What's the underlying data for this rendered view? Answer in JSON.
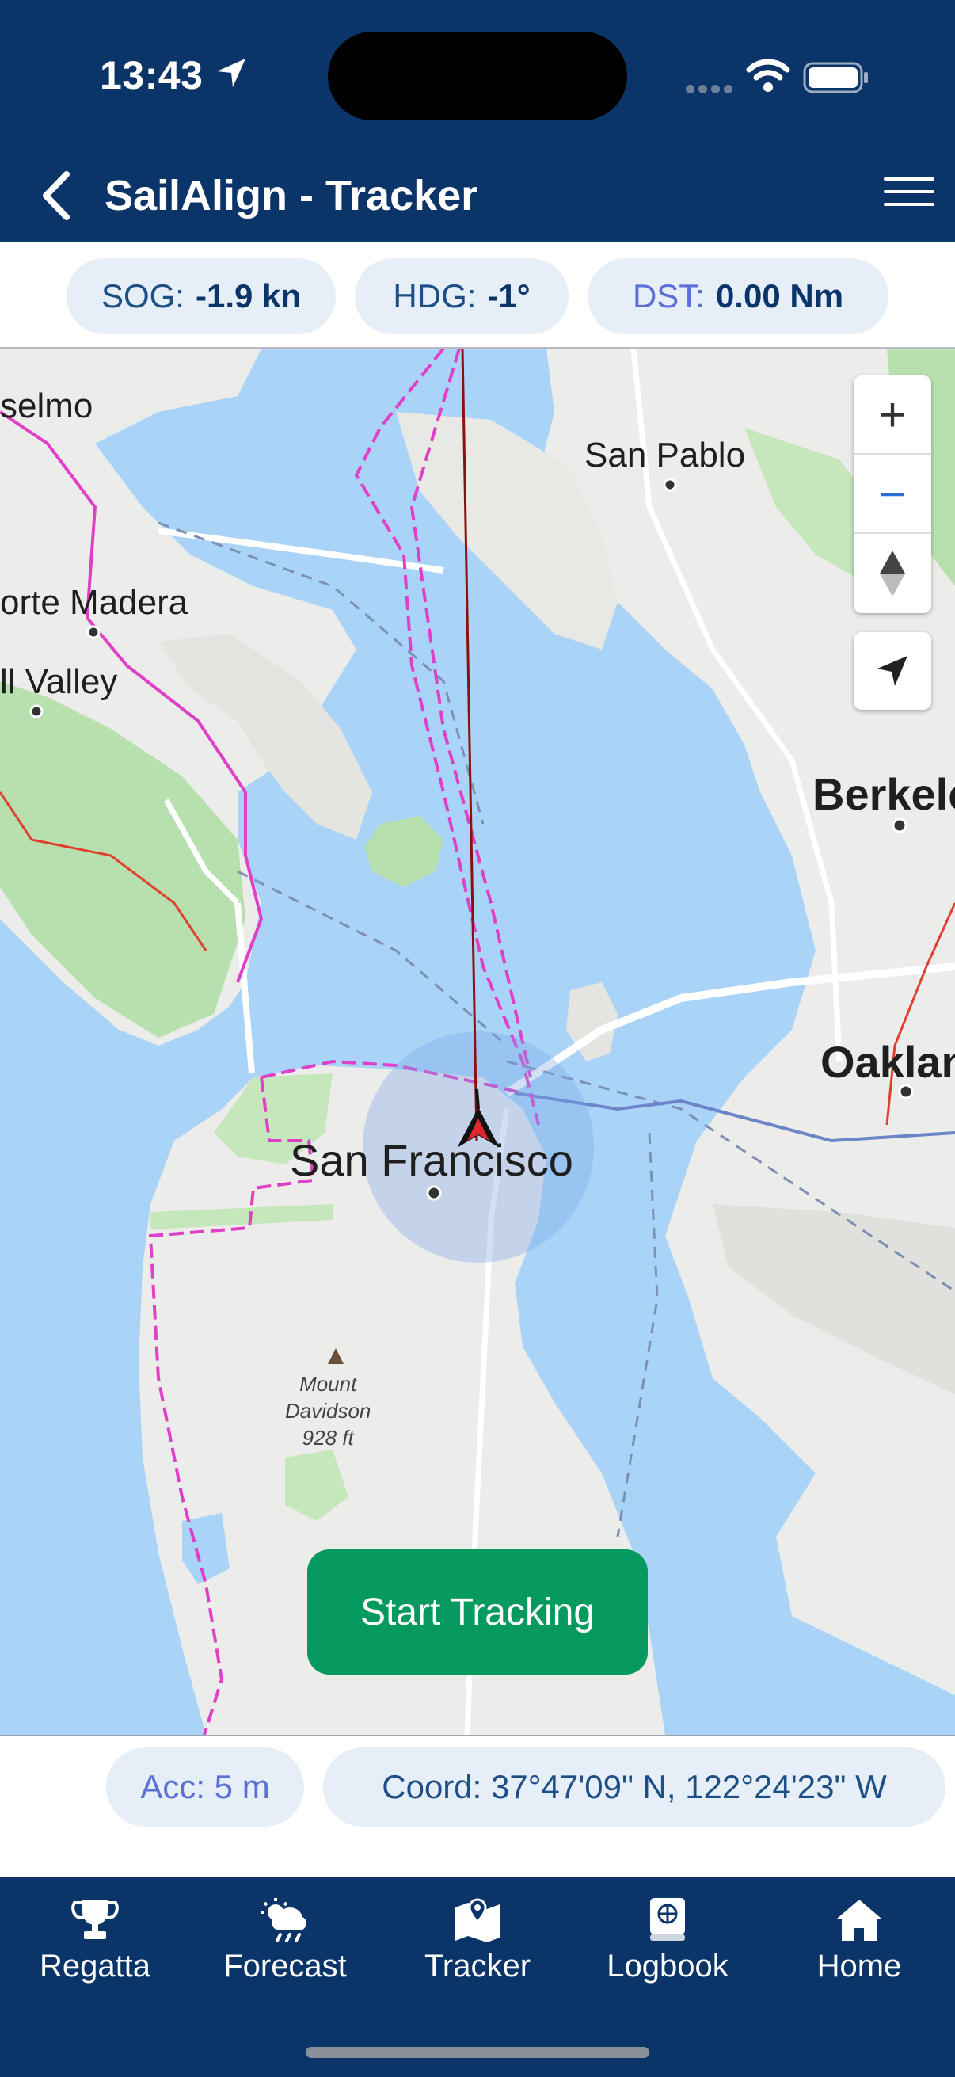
{
  "status_bar": {
    "time": "13:43"
  },
  "header": {
    "title": "SailAlign - Tracker"
  },
  "stats": {
    "sog": {
      "label": "SOG:",
      "value": "-1.9 kn"
    },
    "hdg": {
      "label": "HDG:",
      "value": "-1°"
    },
    "dst": {
      "label": "DST:",
      "value": "0.00 Nm"
    }
  },
  "map": {
    "places": {
      "anselmo": "selmo",
      "san_pablo": "San Pablo",
      "corte_madera": "orte Madera",
      "mill_valley": "ll Valley",
      "berkeley": "Berkele",
      "oakland": "Oaklan",
      "san_francisco": "San Francisco",
      "mount_davidson": [
        "Mount",
        "Davidson",
        "928 ft"
      ]
    },
    "controls": {
      "zoom_in": "+",
      "zoom_out": "−"
    }
  },
  "actions": {
    "start_tracking": "Start Tracking"
  },
  "info": {
    "accuracy": "Acc: 5 m",
    "coord": "Coord: 37°47'09\" N, 122°24'23\" W"
  },
  "tabs": [
    {
      "label": "Regatta",
      "icon": "trophy-icon"
    },
    {
      "label": "Forecast",
      "icon": "weather-icon"
    },
    {
      "label": "Tracker",
      "icon": "map-pin-icon"
    },
    {
      "label": "Logbook",
      "icon": "logbook-icon"
    },
    {
      "label": "Home",
      "icon": "home-icon"
    }
  ],
  "colors": {
    "header_bg": "#0b3469",
    "pill_bg": "#e6eef8",
    "water": "#a9d4f8",
    "start_button": "#079a5e",
    "track_line": "#8b1010",
    "boundary": "#e040c8"
  }
}
